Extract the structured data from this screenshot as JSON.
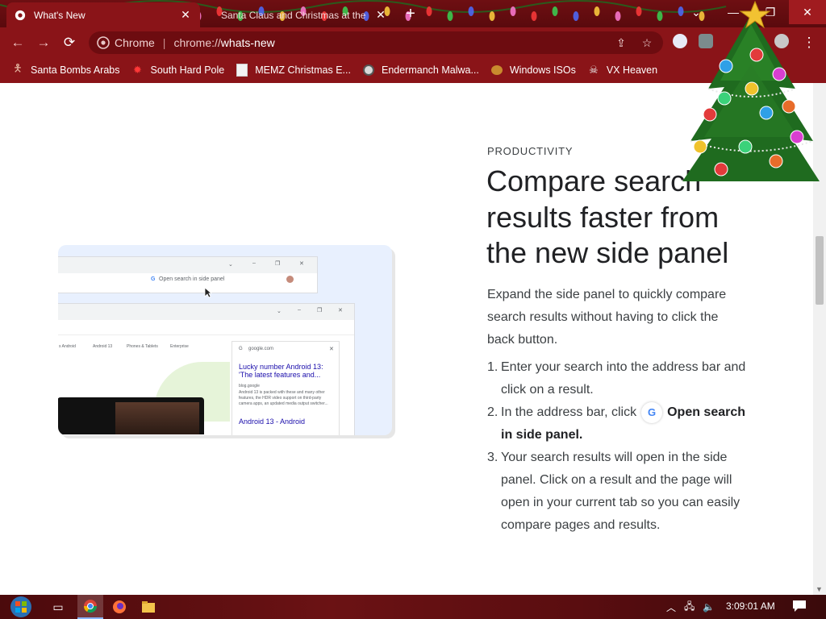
{
  "window": {
    "tabs": [
      {
        "title": "What's New",
        "active": true
      },
      {
        "title": "Santa Claus and Christmas at the",
        "active": false
      }
    ]
  },
  "toolbar": {
    "omnibox_scheme_label": "Chrome",
    "omnibox_url_prefix": "chrome://",
    "omnibox_url_path": "whats-new"
  },
  "bookmarks": [
    {
      "label": "Santa Bombs Arabs",
      "icon": "figure-icon"
    },
    {
      "label": "South Hard Pole",
      "icon": "red-star-icon"
    },
    {
      "label": "MEMZ Christmas E...",
      "icon": "page-icon"
    },
    {
      "label": "Endermanch Malwa...",
      "icon": "raccoon-icon"
    },
    {
      "label": "Windows ISOs",
      "icon": "pumpkin-icon"
    },
    {
      "label": "VX Heaven",
      "icon": "skull-icon"
    }
  ],
  "article": {
    "eyebrow": "PRODUCTIVITY",
    "headline": "Compare search results faster from the new side panel",
    "lede": "Expand the side panel to quickly compare search results without having to click the back button.",
    "step1": "Enter your search into the address bar and click on a result.",
    "step2_before": "In the address bar, click",
    "step2_chip": "G",
    "step2_bold": "Open search in side panel.",
    "step3": "Your search results will open in the side panel. Click on a result and the page will open in your current tab so you can easily compare pages and results.",
    "num1": "1.",
    "num2": "2.",
    "num3": "3."
  },
  "illustration": {
    "omnibox_chip": "Open search in side panel",
    "side_panel_domain": "google.com",
    "result1_title": "Lucky number Android 13: 'The latest features and...",
    "result1_source": "blog.google",
    "result1_snippet": "Android 13 is packed with these and many other features, the HDR video support on third-party camera apps, an updated media output switcher...",
    "result2_title": "Android 13 - Android",
    "page_nav": [
      "s Android",
      "Android 13",
      "Phones & Tablets",
      "Enterprise"
    ]
  },
  "taskbar": {
    "clock": "3:09:01 AM"
  },
  "colors": {
    "titlebar": "#6e0f12",
    "toolbar": "#8a1418",
    "omnibox": "#6d0c10",
    "link": "#1a0dab"
  }
}
